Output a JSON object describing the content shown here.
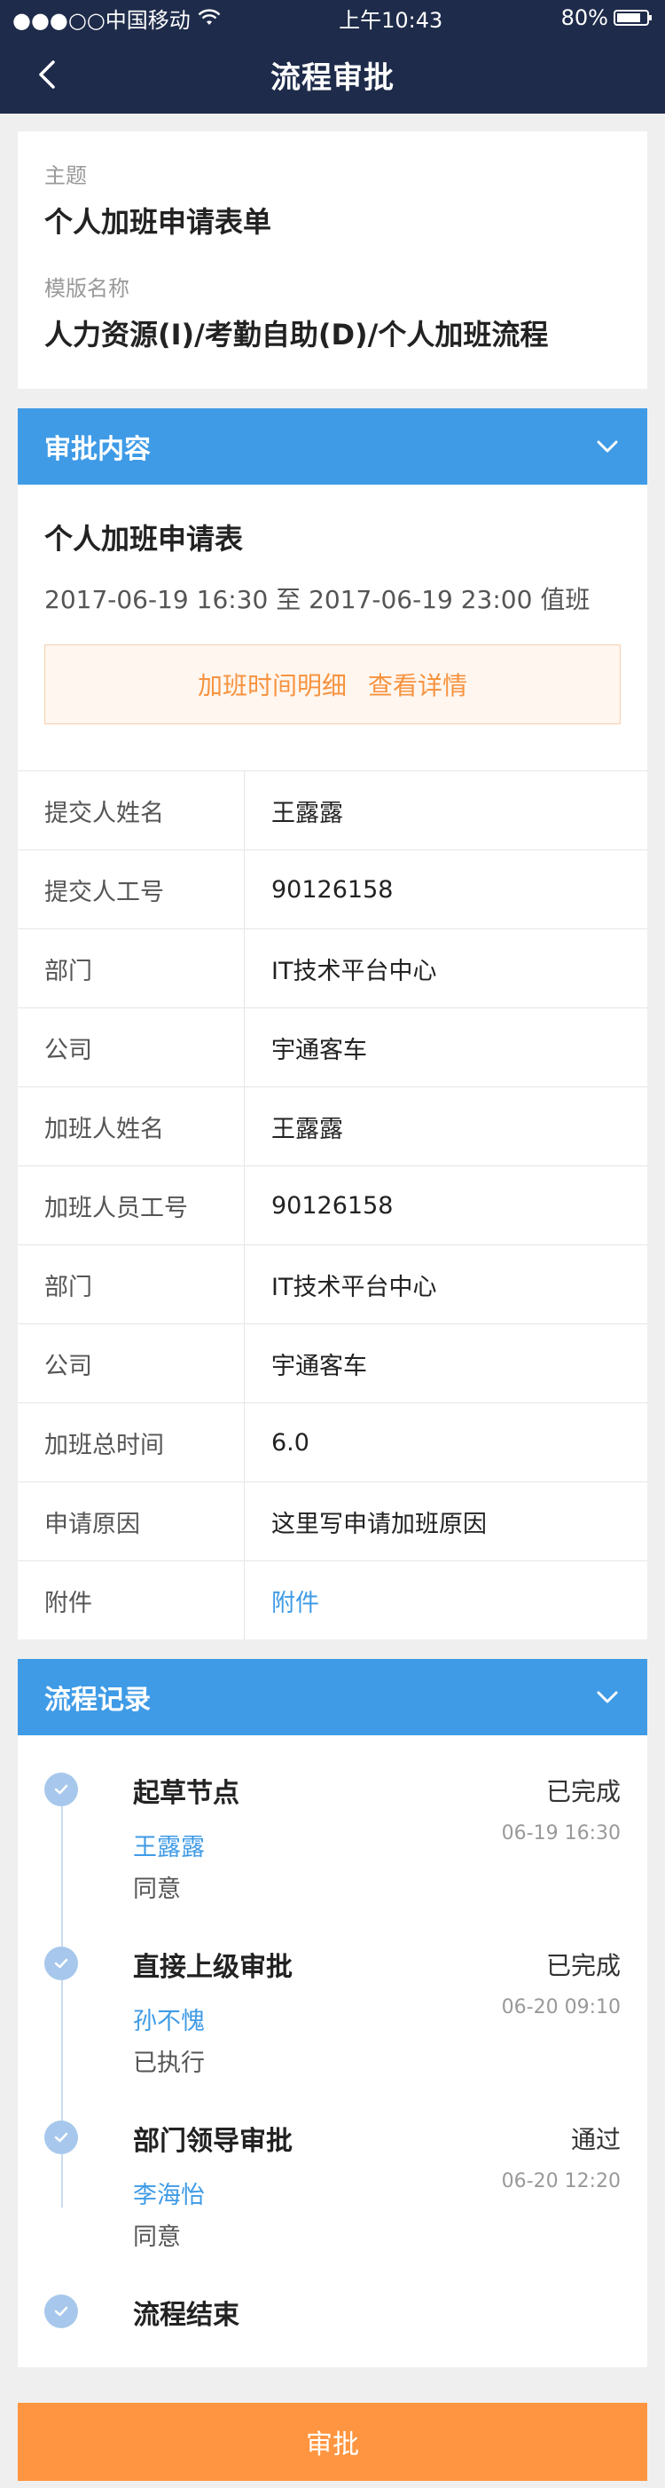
{
  "status_bar": {
    "carrier": "●●●○○中国移动",
    "time": "上午10:43",
    "battery": "80%"
  },
  "nav": {
    "title": "流程审批"
  },
  "subject": {
    "theme_label": "主题",
    "theme_value": "个人加班申请表单",
    "template_label": "模版名称",
    "template_value": "人力资源(I)/考勤自助(D)/个人加班流程"
  },
  "approval_content": {
    "header": "审批内容",
    "form_title": "个人加班申请表",
    "time_range": "2017-06-19   16:30  至  2017-06-19   23:00  值班",
    "notice_text": "加班时间明细",
    "notice_link": "查看详情",
    "rows": [
      {
        "label": "提交人姓名",
        "value": "王露露"
      },
      {
        "label": "提交人工号",
        "value": "90126158"
      },
      {
        "label": "部门",
        "value": "IT技术平台中心"
      },
      {
        "label": "公司",
        "value": "宇通客车"
      },
      {
        "label": "加班人姓名",
        "value": "王露露"
      },
      {
        "label": "加班人员工号",
        "value": "90126158"
      },
      {
        "label": "部门",
        "value": "IT技术平台中心"
      },
      {
        "label": "公司",
        "value": "宇通客车"
      },
      {
        "label": "加班总时间",
        "value": "6.0"
      },
      {
        "label": "申请原因",
        "value": "这里写申请加班原因"
      },
      {
        "label": "附件",
        "value": "附件"
      }
    ]
  },
  "process": {
    "header": "流程记录",
    "steps": [
      {
        "node": "起草节点",
        "status": "已完成",
        "person": "王露露",
        "time": "06-19 16:30",
        "comment": "同意"
      },
      {
        "node": "直接上级审批",
        "status": "已完成",
        "person": "孙不愧",
        "time": "06-20 09:10",
        "comment": "已执行"
      },
      {
        "node": "部门领导审批",
        "status": "通过",
        "person": "李海怡",
        "time": "06-20 12:20",
        "comment": "同意"
      },
      {
        "node": "流程结束"
      }
    ]
  },
  "approve_button": "审批",
  "colors": {
    "nav_bg": "#1e2b4a",
    "section_header": "#3f9be6",
    "accent_orange": "#ff9540",
    "link_blue": "#3f9be6"
  }
}
